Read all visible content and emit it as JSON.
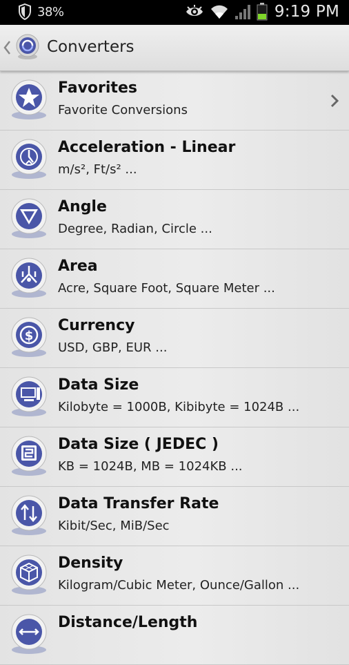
{
  "status_bar": {
    "battery_percent": "38%",
    "time": "9:19 PM",
    "icons": [
      "shield-icon",
      "eye-icon",
      "wifi-icon",
      "signal-icon",
      "battery-icon"
    ],
    "battery_level": 0.38,
    "battery_color": "#7fd62a"
  },
  "title_bar": {
    "title": "Converters",
    "icons": [
      "back-chevron-icon",
      "app-logo-icon"
    ]
  },
  "accent_color": "#4a56a8",
  "list": [
    {
      "title": "Favorites",
      "subtitle": "Favorite Conversions",
      "icon": "star-icon",
      "has_chevron": true
    },
    {
      "title": "Acceleration - Linear",
      "subtitle": "m/s², Ft/s² ...",
      "icon": "acceleration-icon"
    },
    {
      "title": "Angle",
      "subtitle": "Degree, Radian, Circle ...",
      "icon": "angle-icon"
    },
    {
      "title": "Area",
      "subtitle": "Acre, Square Foot, Square Meter ...",
      "icon": "area-icon"
    },
    {
      "title": "Currency",
      "subtitle": "USD, GBP, EUR ...",
      "icon": "currency-icon"
    },
    {
      "title": "Data Size",
      "subtitle": "Kilobyte = 1000B, Kibibyte = 1024B ...",
      "icon": "computer-icon"
    },
    {
      "title": "Data Size ( JEDEC )",
      "subtitle": "KB = 1024B, MB = 1024KB ...",
      "icon": "jedec-icon"
    },
    {
      "title": "Data Transfer Rate",
      "subtitle": "Kibit/Sec, MiB/Sec",
      "icon": "transfer-icon"
    },
    {
      "title": "Density",
      "subtitle": "Kilogram/Cubic Meter, Ounce/Gallon ...",
      "icon": "cube-icon"
    },
    {
      "title": "Distance/Length",
      "subtitle": "",
      "icon": "distance-icon"
    }
  ]
}
